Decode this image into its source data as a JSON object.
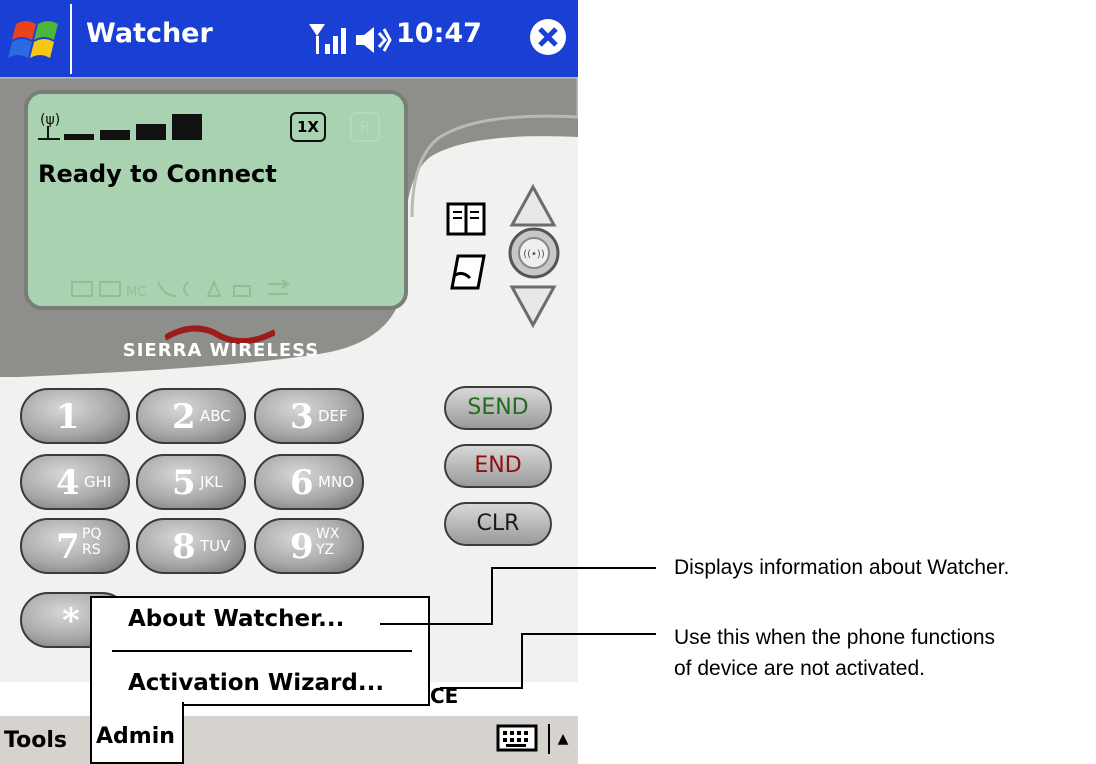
{
  "titlebar": {
    "app_title": "Watcher",
    "clock": "10:47",
    "icons": [
      "windows-start-icon",
      "signal-strength-icon",
      "speaker-icon",
      "close-icon"
    ]
  },
  "lcd": {
    "status": "Ready to Connect",
    "indicator_1x": "1X",
    "indicator_r": "R"
  },
  "brand": "SIERRA WIRELESS",
  "side_buttons": {
    "send": "SEND",
    "end": "END",
    "clr": "CLR"
  },
  "keypad": [
    {
      "num": "1",
      "letters": ""
    },
    {
      "num": "2",
      "letters": "ABC"
    },
    {
      "num": "3",
      "letters": "DEF"
    },
    {
      "num": "4",
      "letters": "GHI"
    },
    {
      "num": "5",
      "letters": "JKL"
    },
    {
      "num": "6",
      "letters": "MNO"
    },
    {
      "num": "7",
      "letters": "PQ RS"
    },
    {
      "num": "8",
      "letters": "TUV"
    },
    {
      "num": "9",
      "letters": "WX YZ"
    },
    {
      "num": "*",
      "letters": ""
    }
  ],
  "popup_menu": {
    "items": [
      "About Watcher...",
      "Activation Wizard..."
    ]
  },
  "partial_label": "CE",
  "menubar": {
    "tools": "Tools",
    "admin": "Admin"
  },
  "callouts": {
    "about": "Displays information about Watcher.",
    "wizard_line1": "Use this when the phone functions",
    "wizard_line2": "of device are not activated."
  },
  "colors": {
    "titlebar": "#1a3fd4",
    "lcd": "#a9d3b0",
    "send": "#1e6e1e",
    "end": "#8e1010"
  }
}
